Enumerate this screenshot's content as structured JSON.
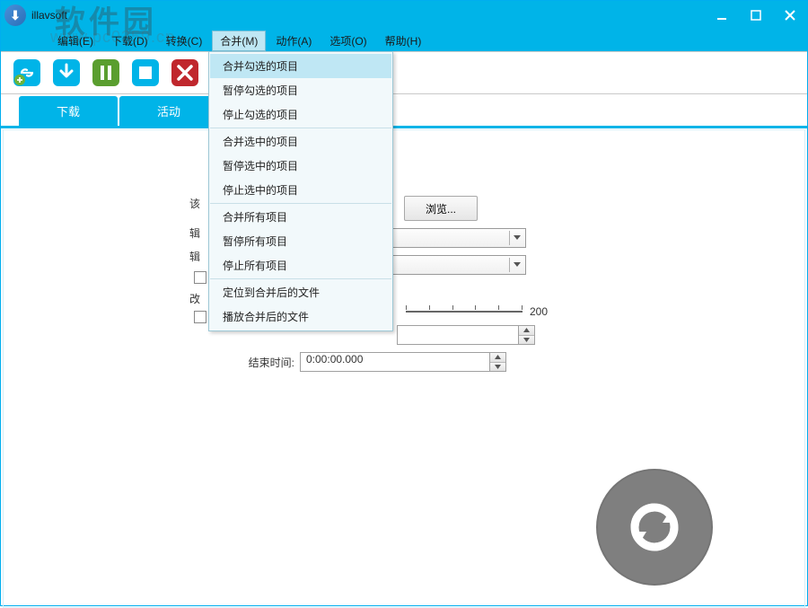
{
  "title": "illavsoft",
  "watermark": "软件园",
  "watermark_small": "www.pc0359.cn",
  "menubar": {
    "items": [
      {
        "label": "编辑(E)"
      },
      {
        "label": "下载(D)"
      },
      {
        "label": "转换(C)"
      },
      {
        "label": "合并(M)"
      },
      {
        "label": "动作(A)"
      },
      {
        "label": "选项(O)"
      },
      {
        "label": "帮助(H)"
      }
    ]
  },
  "dropdown_menu": {
    "groups": [
      [
        {
          "label": "合并勾选的项目"
        },
        {
          "label": "暂停勾选的项目"
        },
        {
          "label": "停止勾选的项目"
        }
      ],
      [
        {
          "label": "合并选中的项目"
        },
        {
          "label": "暂停选中的项目"
        },
        {
          "label": "停止选中的项目"
        }
      ],
      [
        {
          "label": "合并所有项目"
        },
        {
          "label": "暂停所有项目"
        },
        {
          "label": "停止所有项目"
        }
      ],
      [
        {
          "label": "定位到合并后的文件"
        },
        {
          "label": "播放合并后的文件"
        }
      ]
    ]
  },
  "tabs": {
    "items": [
      {
        "label": "下载"
      },
      {
        "label": "活动"
      }
    ]
  },
  "form": {
    "browse": "浏览...",
    "peek1": "该",
    "peek2": "辑",
    "peek3": "辑",
    "slider_value": "200",
    "peek5": "改",
    "end_time_label": "结束时间:",
    "end_time_value": "0:00:00.000"
  }
}
